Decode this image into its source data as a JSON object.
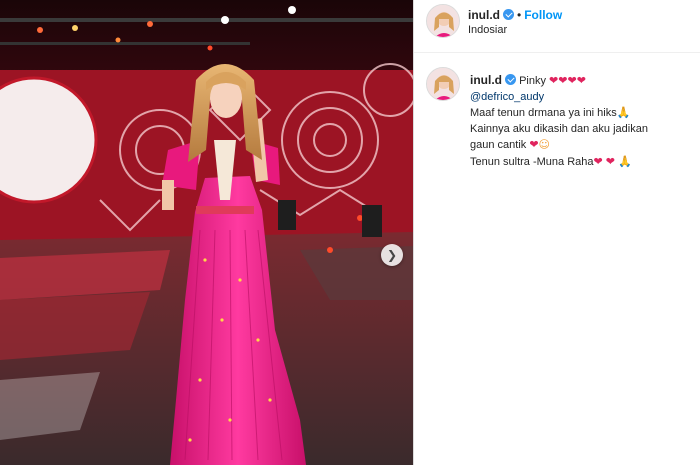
{
  "post": {
    "photo_alt": "",
    "header": {
      "username": "inul.d",
      "separator": "•",
      "follow_label": "Follow",
      "location": "Indosiar"
    },
    "caption": {
      "username": "inul.d",
      "line1_text": "Pinky",
      "line2_mention": "@defrico_audy",
      "line3_text": "Maaf tenun drmana ya ini hiks",
      "line4_text": "Kainnya aku dikasih dan aku jadikan",
      "line5_text": "gaun cantik",
      "line6_text": "Tenun sultra -Muna Raha"
    },
    "icons": {
      "verified": "verified-badge-icon",
      "heart": "red-heart-icon",
      "pray": "folded-hands-icon",
      "blush": "smiling-face-icon",
      "next": "chevron-right-icon"
    },
    "colors": {
      "follow": "#0095f6",
      "verified": "#3897f0",
      "mention": "#00376b",
      "dress": "#e8197d"
    }
  }
}
